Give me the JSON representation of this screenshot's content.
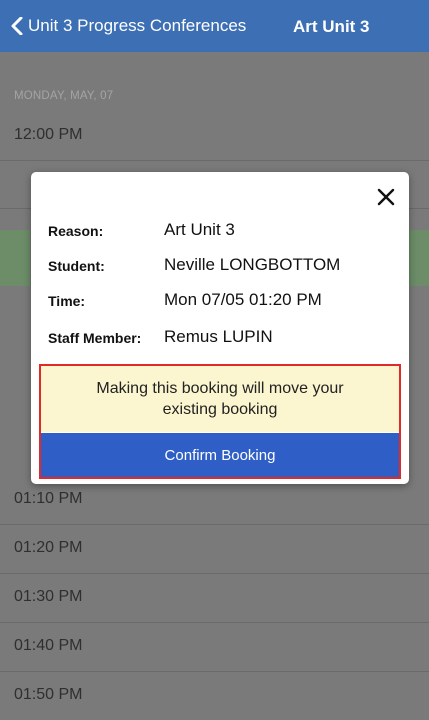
{
  "header": {
    "back_label": "Unit 3 Progress Conferences",
    "title": "Art Unit 3"
  },
  "list": {
    "date_label": "MONDAY, MAY, 07",
    "slots": [
      "12:00 PM",
      "01:10 PM",
      "01:20 PM",
      "01:30 PM",
      "01:40 PM",
      "01:50 PM"
    ]
  },
  "modal": {
    "fields": [
      {
        "label": "Reason:",
        "value": "Art Unit 3"
      },
      {
        "label": "Student:",
        "value": "Neville LONGBOTTOM"
      },
      {
        "label": "Time:",
        "value": "Mon 07/05 01:20 PM"
      },
      {
        "label": "Staff Member:",
        "value": "Remus LUPIN"
      }
    ],
    "warning_line1": "Making this booking will move your",
    "warning_line2": "existing booking",
    "confirm_label": "Confirm Booking",
    "close_icon": "close-icon"
  },
  "colors": {
    "header": "#3c6fb4",
    "overlay": "#7a7a7a",
    "warning_bg": "#fbf6cf",
    "confirm_bg": "#2f5fc6",
    "highlight_border": "#e02a2a"
  }
}
